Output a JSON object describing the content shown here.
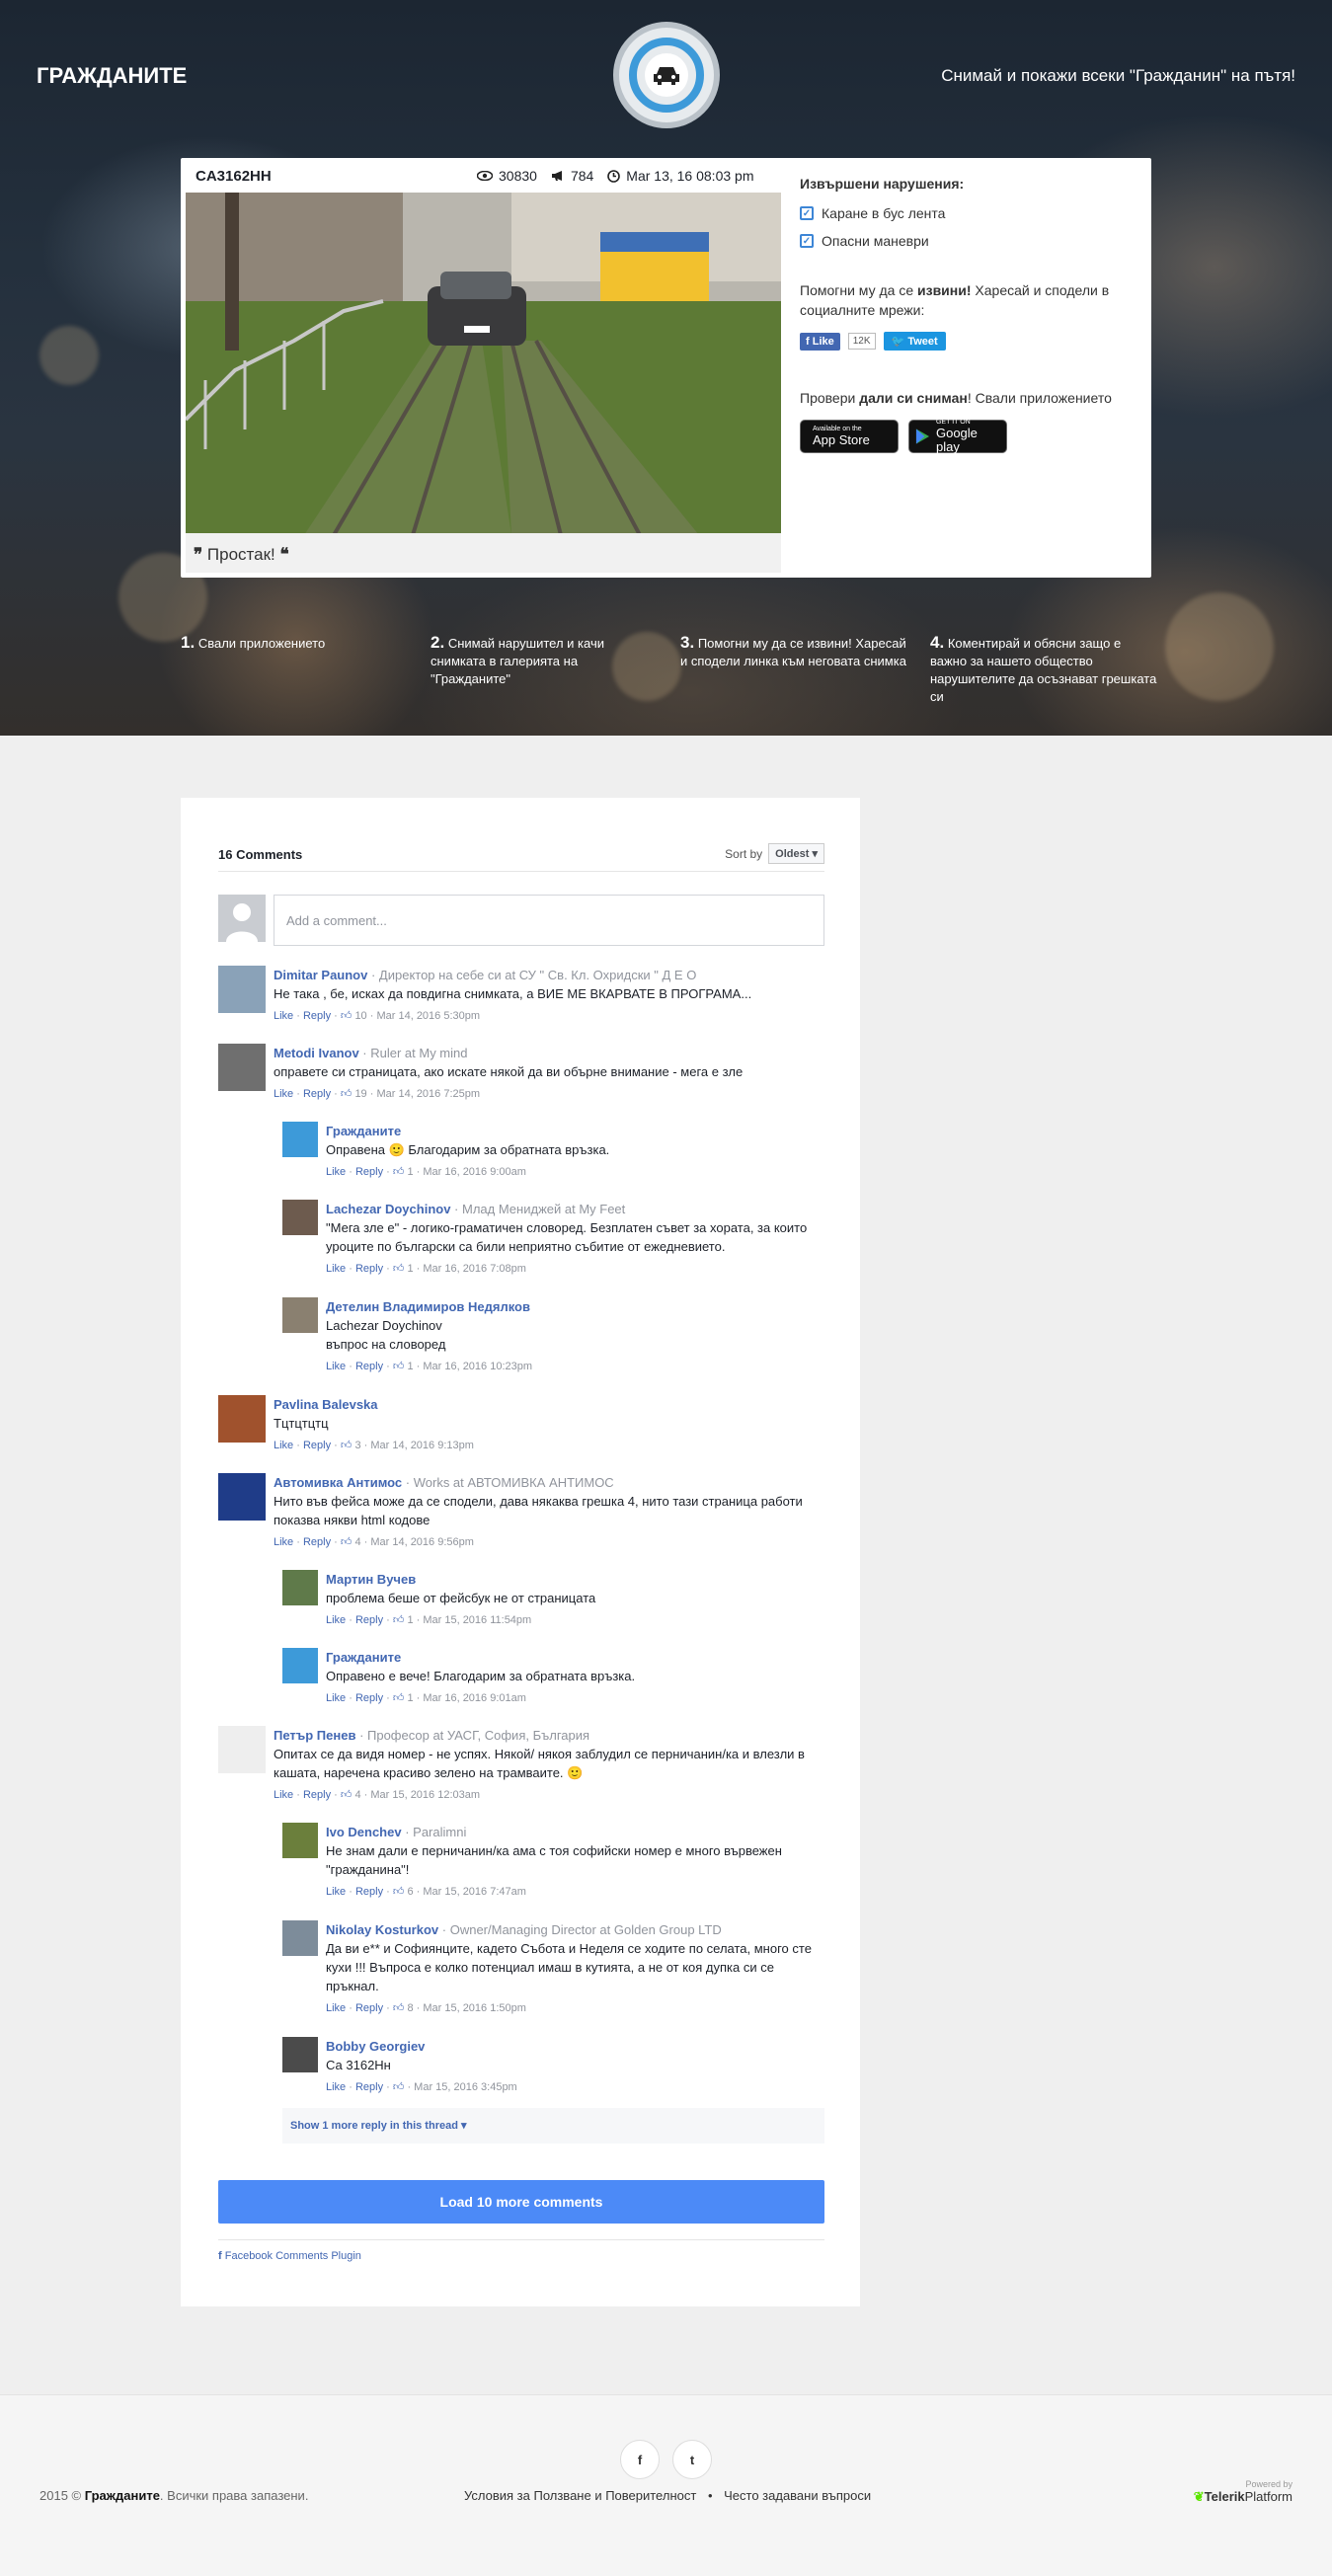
{
  "header": {
    "brand": "ГРАЖДАНИТЕ",
    "tagline": "Снимай и покажи всеки \"Гражданин\" на пътя!"
  },
  "violation": {
    "plate": "CA3162HH",
    "views": "30830",
    "shares": "784",
    "date": "Mar 13, 16 08:03 pm",
    "caption": "Простак!",
    "side_title": "Извършени нарушения:",
    "violations": [
      "Каране в бус лента",
      "Опасни маневри"
    ],
    "help_text_pre": "Помогни му да се ",
    "help_text_bold": "извини!",
    "help_text_post": " Харесай и сподели в социалните мрежи:",
    "fb_like": "Like",
    "fb_count": "12K",
    "tweet": "Tweet",
    "check_pre": "Провери ",
    "check_bold": "дали си сниман",
    "check_post": "! Свали приложението",
    "appstore_top": "Available on the",
    "appstore_bottom": "App Store",
    "googleplay_top": "GET IT ON",
    "googleplay_bottom": "Google play"
  },
  "steps": [
    {
      "num": "1.",
      "text": "Свали приложението"
    },
    {
      "num": "2.",
      "text": "Снимай нарушител и качи снимката в галерията на \"Гражданите\""
    },
    {
      "num": "3.",
      "text": "Помогни му да се извини! Харесай и сподели линка към неговата снимка"
    },
    {
      "num": "4.",
      "text": "Коментирай и обясни защо е важно за нашето общество нарушителите да осъзнават грешката си"
    }
  ],
  "comments": {
    "count": "16 Comments",
    "sort_label": "Sort by",
    "sort_value": "Oldest",
    "add_placeholder": "Add a comment...",
    "like": "Like",
    "reply": "Reply",
    "items": [
      {
        "name": "Dimitar Paunov",
        "sub": " · Директор на себе си at СУ \" Св. Кл. Охридски \" Д Е О",
        "text": "Не така , бе, исках да повдигна снимката, а ВИЕ МЕ ВКАРВАТЕ В ПРОГРАМА...",
        "likes": "10",
        "date": "Mar 14, 2016 5:30pm"
      },
      {
        "name": "Metodi Ivanov",
        "sub": " · Ruler at My mind",
        "text": "оправете си страницата, ако искате някой да ви обърне внимание - мега е зле",
        "likes": "19",
        "date": "Mar 14, 2016 7:25pm"
      },
      {
        "name": "Гражданите",
        "sub": "",
        "text": "Оправена 🙂 Благодарим за обратната връзка.",
        "likes": "1",
        "date": "Mar 16, 2016 9:00am"
      },
      {
        "name": "Lachezar Doychinov",
        "sub": " · Млад Мениджей at My Feet",
        "text": "\"Мега зле е\" - логико-граматичен словоред. Безплатен съвет за хората, за които уроците по български са били неприятно събитие от ежедневието.",
        "likes": "1",
        "date": "Mar 16, 2016 7:08pm"
      },
      {
        "name": "Детелин Владимиров Недялков",
        "sub": "",
        "text": "Lachezar Doychinov\nвъпрос на словоред",
        "likes": "1",
        "date": "Mar 16, 2016 10:23pm"
      },
      {
        "name": "Pavlina Balevska",
        "sub": "",
        "text": "Тцтцтцтц",
        "likes": "3",
        "date": "Mar 14, 2016 9:13pm"
      },
      {
        "name": "Автомивка Антимос",
        "sub": " · Works at АВТОМИВКА АНТИМОС",
        "text": "Нито във фейса може да се сподели, дава някаква грешка 4, нито тази страница работи показва някви html кодове",
        "likes": "4",
        "date": "Mar 14, 2016 9:56pm"
      },
      {
        "name": "Мартин Вучев",
        "sub": "",
        "text": "проблема беше от фейсбук не от страницата",
        "likes": "1",
        "date": "Mar 15, 2016 11:54pm"
      },
      {
        "name": "Гражданите",
        "sub": "",
        "text": "Оправено е вече! Благодарим за обратната връзка.",
        "likes": "1",
        "date": "Mar 16, 2016 9:01am"
      },
      {
        "name": "Петър Пенев",
        "sub": " · Професор at УАСГ, София, България",
        "text": "Опитах се да видя номер - не успях. Някой/ някоя заблудил се перничанин/ка и влезли в кашата, наречена красиво зелено на трамваите. 🙂",
        "likes": "4",
        "date": "Mar 15, 2016 12:03am"
      },
      {
        "name": "Ivo Denchev",
        "sub": " · Paralimni",
        "text": "Не знам дали е перничанин/ка ама с тоя софийски номер е много вървежен \"гражданина\"!",
        "likes": "6",
        "date": "Mar 15, 2016 7:47am"
      },
      {
        "name": "Nikolay Kosturkov",
        "sub": " · Owner/Managing Director at Golden Group LTD",
        "text": "Да ви е** и Софиянците, кадето Събота и Неделя се ходите по селата, много сте кухи !!! Въпроса е колко потенциал имаш в кутията, а не от коя дупка си се пръкнал.",
        "likes": "8",
        "date": "Mar 15, 2016 1:50pm"
      },
      {
        "name": "Bobby Georgiev",
        "sub": "",
        "text": "Са 3162Нн",
        "likes": "",
        "date": "Mar 15, 2016 3:45pm"
      }
    ],
    "show_more": "Show 1 more reply in this thread",
    "load_more": "Load 10 more comments",
    "plugin": "Facebook Comments Plugin"
  },
  "footer": {
    "facebook": "f",
    "twitter": "t",
    "copy_pre": "2015 © ",
    "copy_brand": "Гражданите",
    "copy_post": ". Всички права запазени.",
    "terms": "Условия за Ползване и Поверителност",
    "sep": "•",
    "faq": "Често задавани въпроси",
    "powered": "Powered by",
    "telerik": "Telerik",
    "platform": "Platform"
  },
  "colors": {
    "accent": "#3d86d6",
    "fb": "#4267b2",
    "load": "#4c8af7"
  }
}
